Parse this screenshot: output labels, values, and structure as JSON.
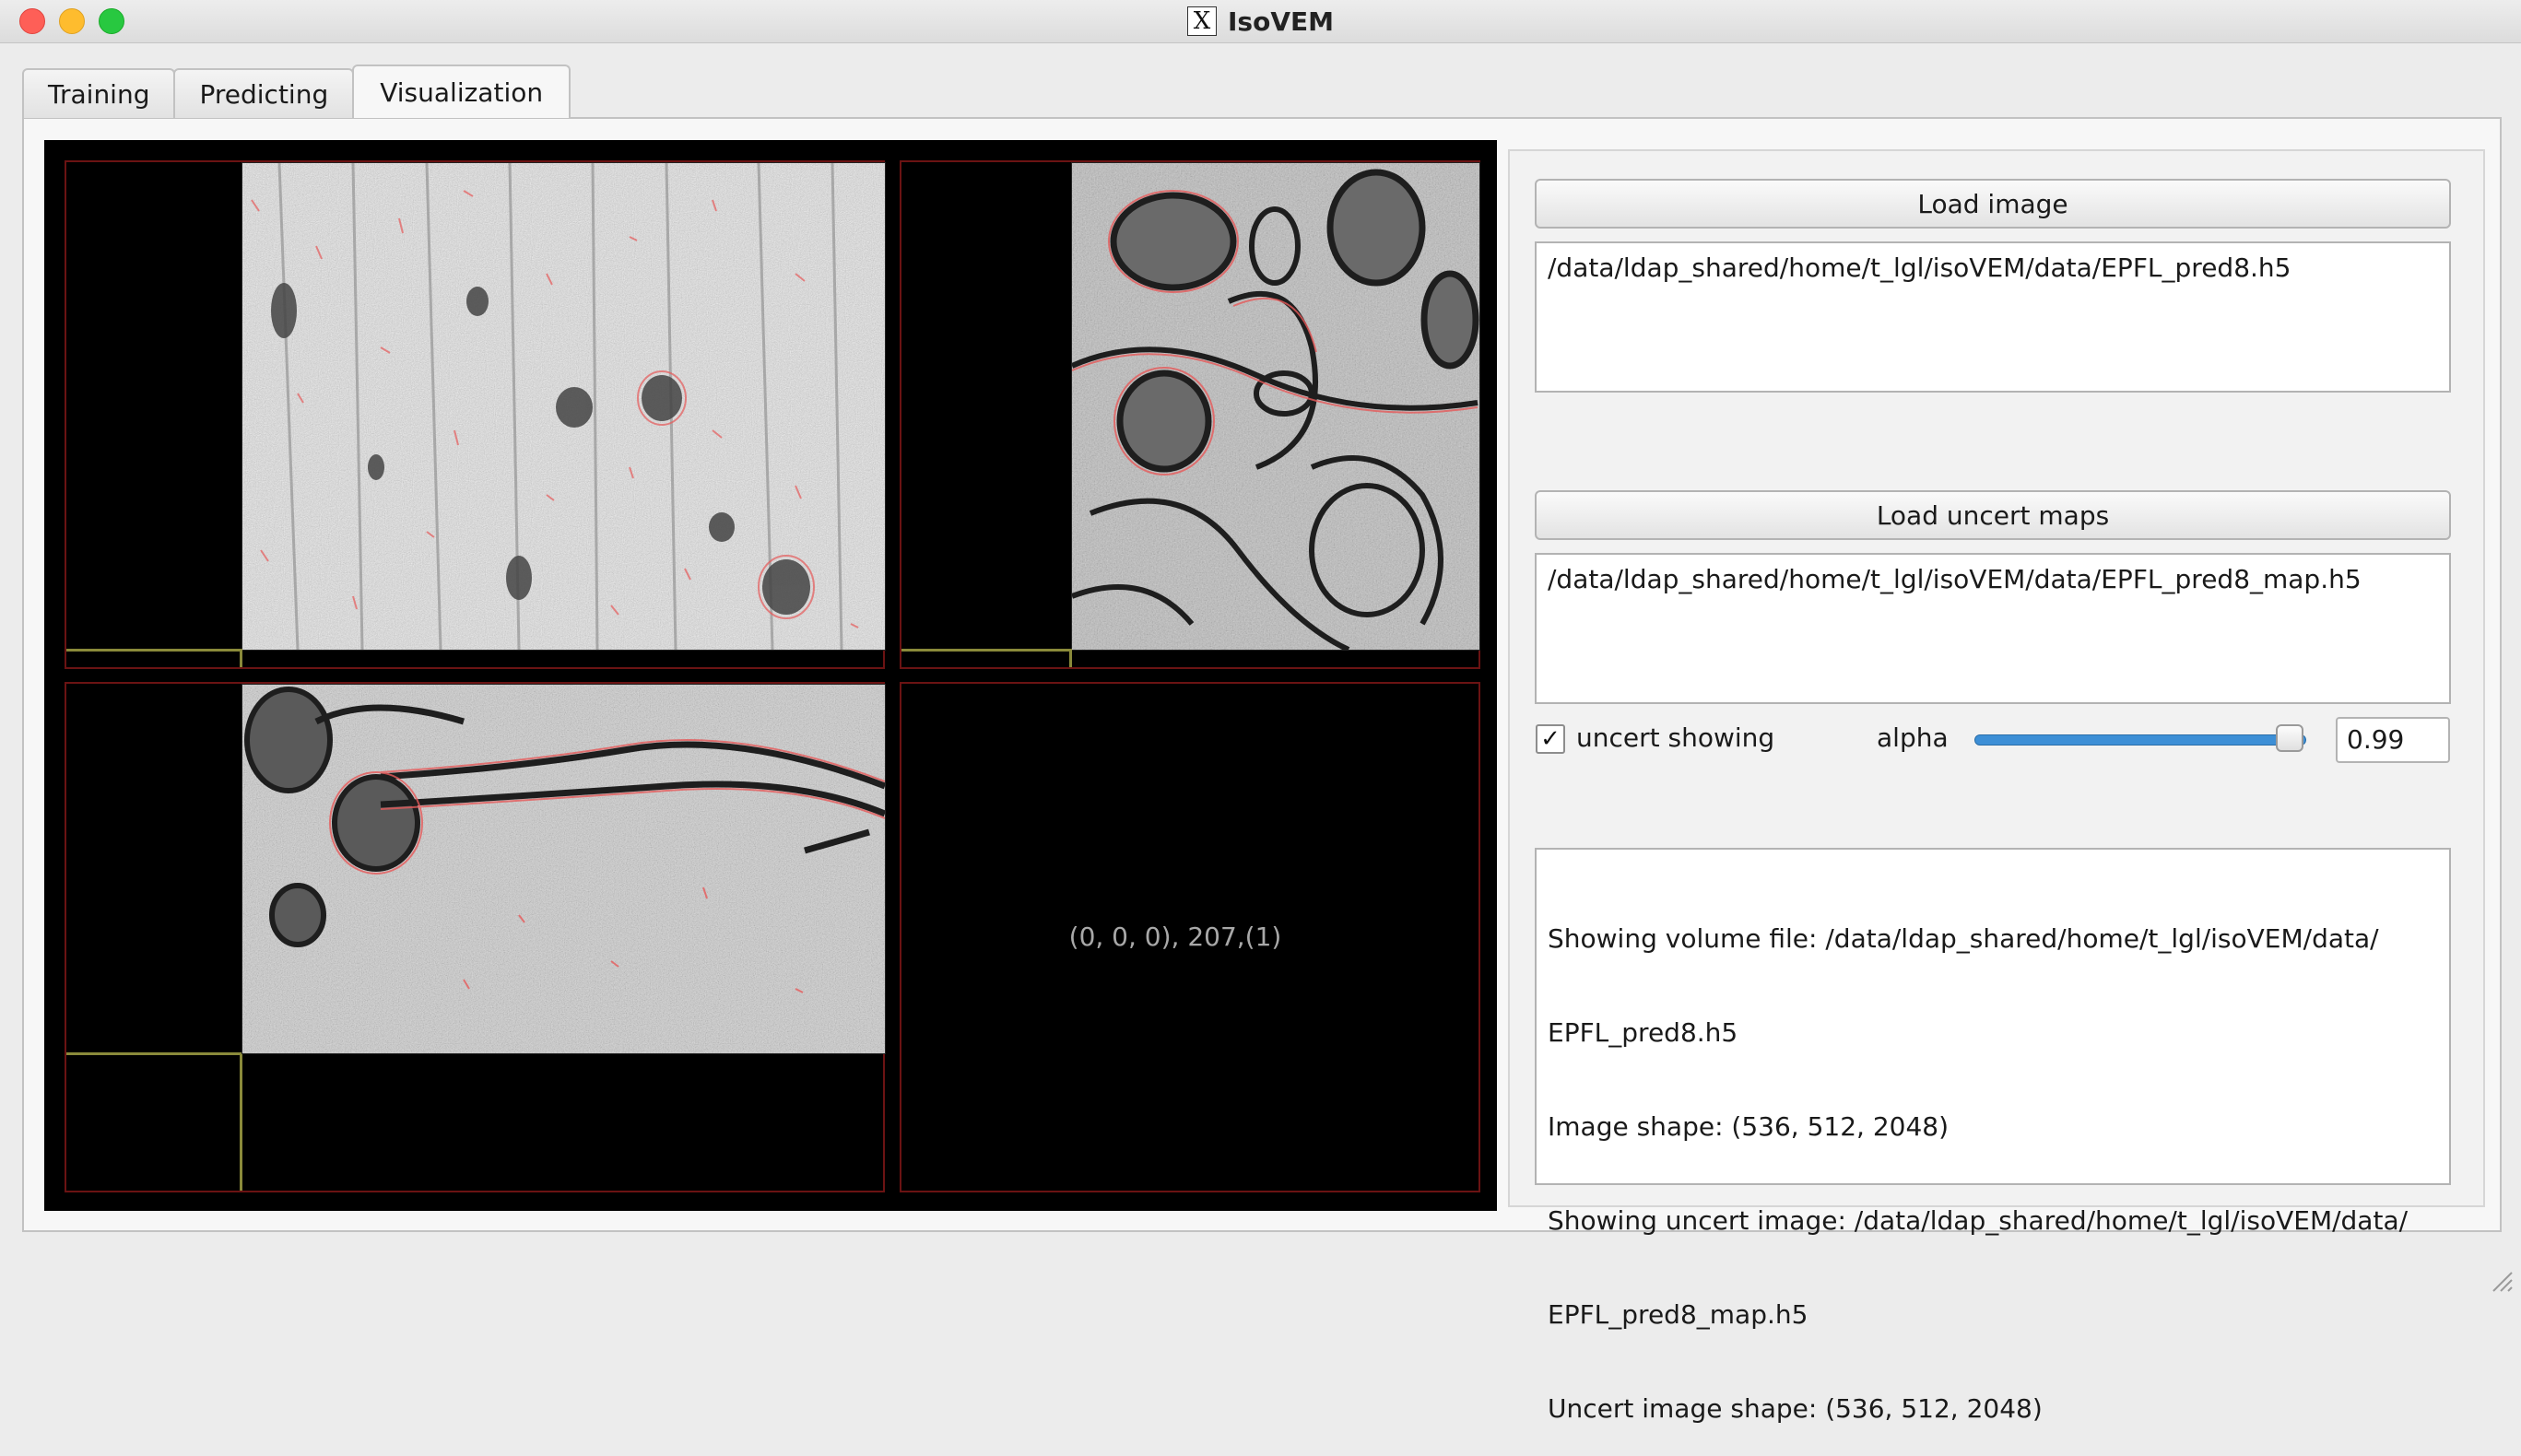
{
  "window": {
    "title": "IsoVEM",
    "app_icon": "x11-icon"
  },
  "tabs": [
    {
      "label": "Training"
    },
    {
      "label": "Predicting"
    },
    {
      "label": "Visualization"
    }
  ],
  "viewer": {
    "coords_text": "(0, 0, 0), 207,(1)"
  },
  "image_section": {
    "load_button": "Load image",
    "path": "/data/ldap_shared/home/t_lgl/isoVEM/data/EPFL_pred8.h5"
  },
  "uncert_section": {
    "load_button": "Load uncert maps",
    "path": "/data/ldap_shared/home/t_lgl/isoVEM/data/EPFL_pred8_map.h5"
  },
  "controls": {
    "uncert_checkbox_label": "uncert showing",
    "uncert_checked": true,
    "alpha_label": "alpha",
    "alpha_value": "0.99",
    "alpha_fraction": 0.99
  },
  "log": {
    "lines": [
      "Showing volume file: /data/ldap_shared/home/t_lgl/isoVEM/data/",
      "EPFL_pred8.h5",
      "Image shape: (536, 512, 2048)",
      "Showing uncert image: /data/ldap_shared/home/t_lgl/isoVEM/data/",
      "EPFL_pred8_map.h5",
      "Uncert image shape: (536, 512, 2048)"
    ]
  },
  "colors": {
    "frame": "#6b1313",
    "crosshair": "#8a8a3a",
    "slider_fill": "#3d8fd6"
  }
}
